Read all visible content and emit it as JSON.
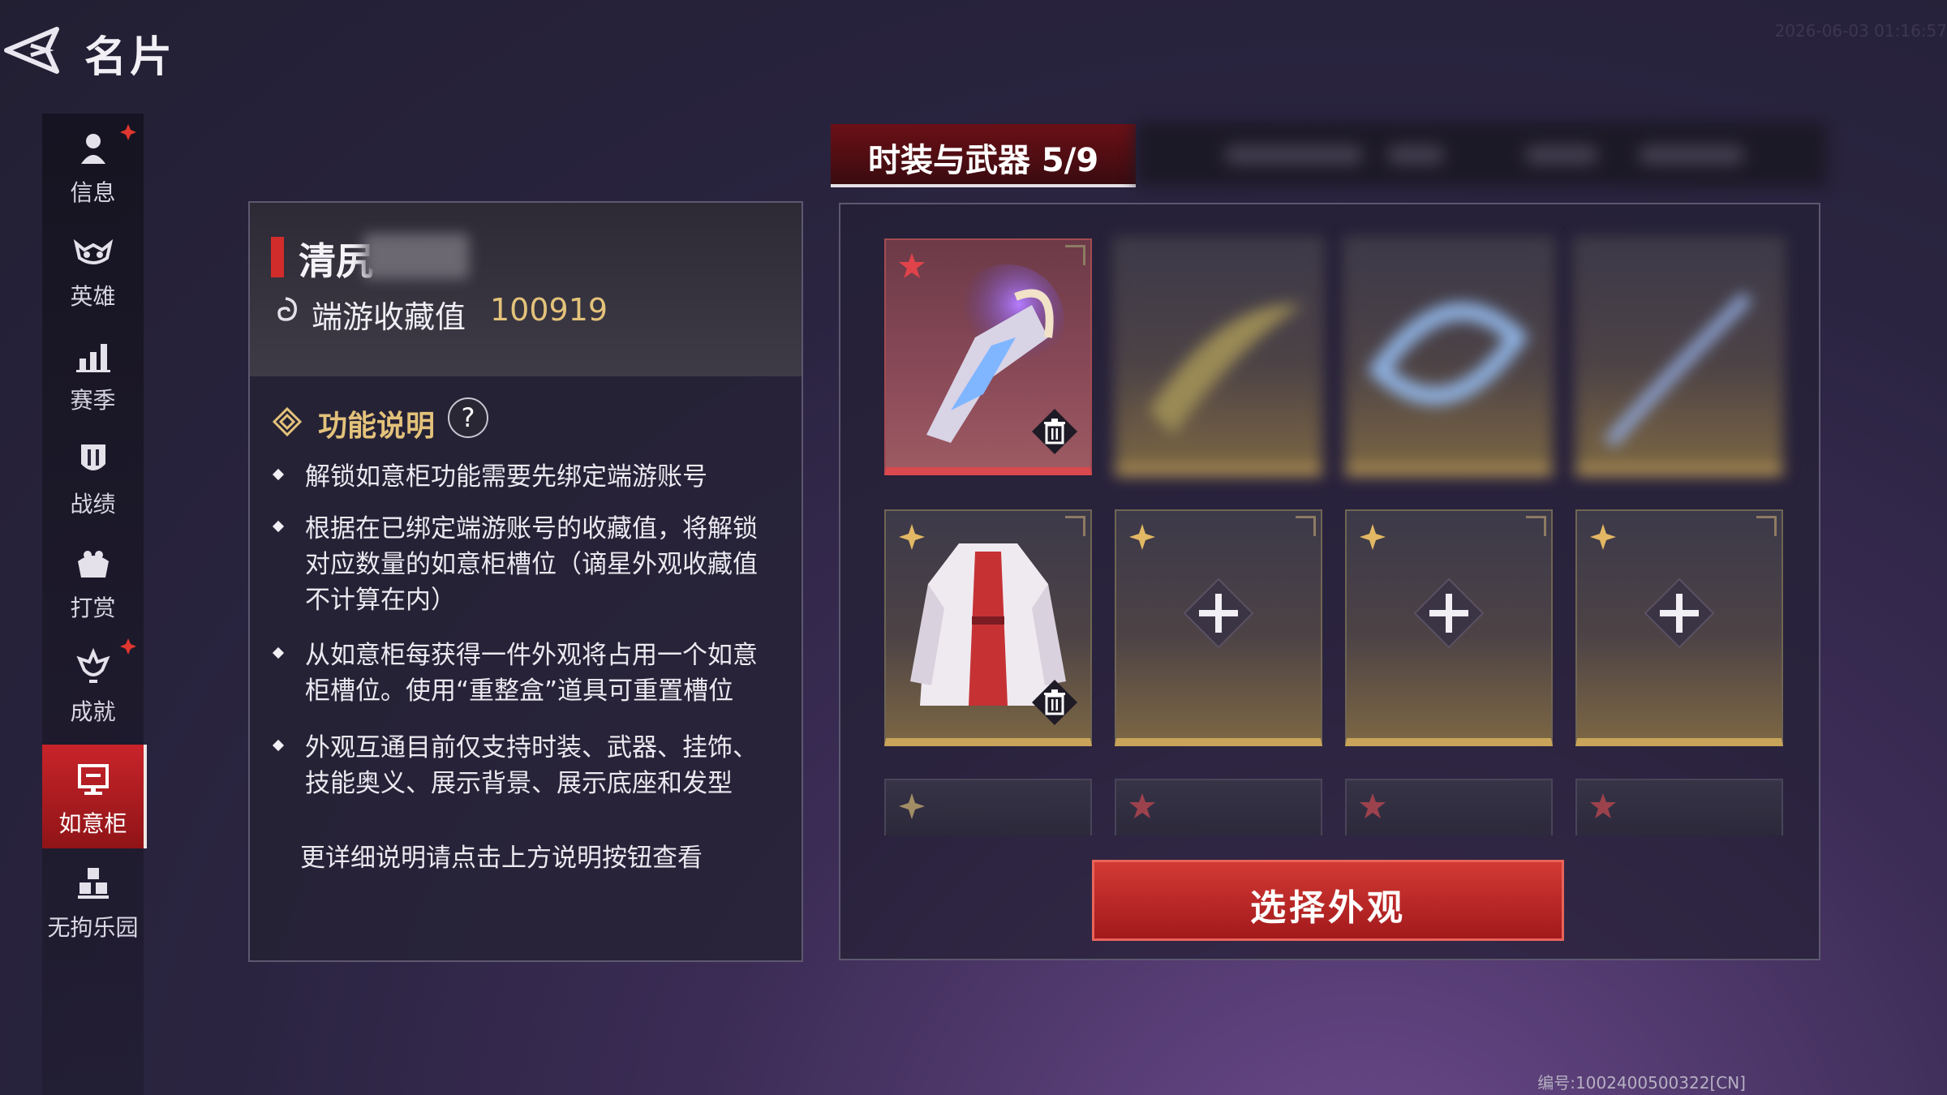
{
  "header": {
    "title": "名片",
    "timestamp": "2026-06-03 01:16:57"
  },
  "sidebar": {
    "items": [
      {
        "label": "信息",
        "icon": "person-icon",
        "badge": true
      },
      {
        "label": "英雄",
        "icon": "mask-icon",
        "badge": false
      },
      {
        "label": "赛季",
        "icon": "bar-chart-icon",
        "badge": false
      },
      {
        "label": "战绩",
        "icon": "shield-icon",
        "badge": false
      },
      {
        "label": "打赏",
        "icon": "gift-icon",
        "badge": false
      },
      {
        "label": "成就",
        "icon": "trophy-icon",
        "badge": true
      },
      {
        "label": "如意柜",
        "icon": "cabinet-icon",
        "badge": false,
        "active": true
      },
      {
        "label": "无拘乐园",
        "icon": "cubes-icon",
        "badge": false
      }
    ]
  },
  "profile": {
    "name": "清尻",
    "collection_label": "端游收藏值",
    "collection_value": "100919"
  },
  "instructions": {
    "title": "功能说明",
    "help": "?",
    "bullets": [
      "解锁如意柜功能需要先绑定端游账号",
      "根据在已绑定端游账号的收藏值，将解锁对应数量的如意柜槽位（谪星外观收藏值不计算在内）",
      "从如意柜每获得一件外观将占用一个如意柜槽位。使用“重整盒”道具可重置槽位",
      "外观互通目前仅支持时装、武器、挂饰、技能奥义、展示背景、展示底座和发型"
    ],
    "more": "更详细说明请点击上方说明按钮查看"
  },
  "tabs": {
    "active_label": "时装与武器 5/9"
  },
  "select_button": "选择外观",
  "footer": {
    "id": "编号:1002400500322[CN]"
  },
  "colors": {
    "accent_red": "#c8242a",
    "gold": "#e3c27a",
    "slot_gold_bar": "#c8a45a",
    "slot_red_bar": "#d9494d"
  }
}
